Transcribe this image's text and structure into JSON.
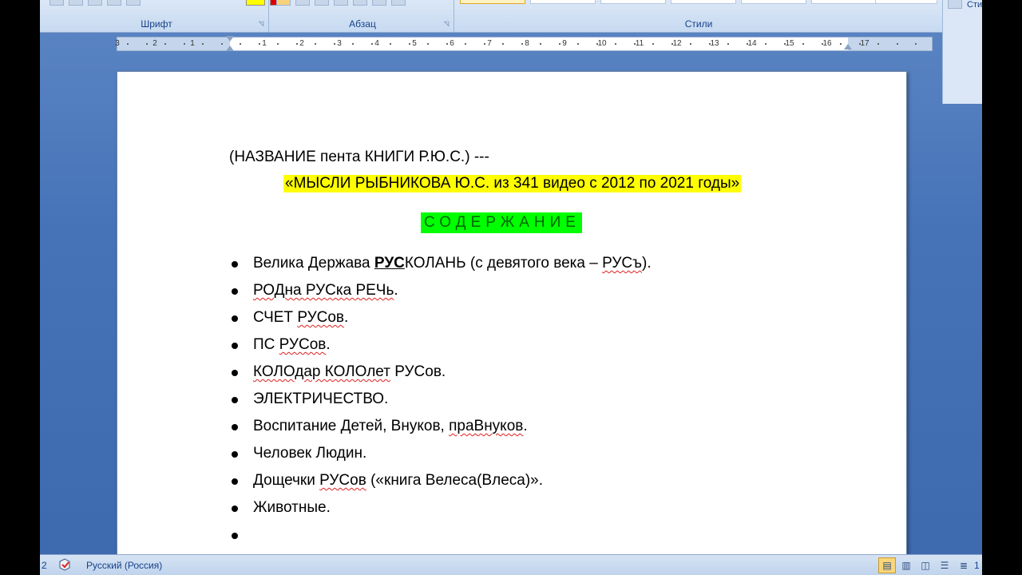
{
  "ribbon": {
    "groups": [
      {
        "label": "Шрифт"
      },
      {
        "label": "Абзац"
      },
      {
        "label": "Стили"
      }
    ],
    "styles_button_label": "Стили"
  },
  "ruler": {
    "left_ticks": [
      "3",
      "2",
      "1"
    ],
    "right_ticks": [
      "1",
      "2",
      "3",
      "4",
      "5",
      "6",
      "7",
      "8",
      "9",
      "10",
      "11",
      "12",
      "13",
      "14",
      "15",
      "16",
      "17"
    ]
  },
  "document": {
    "heading": "(НАЗВАНИЕ пента КНИГИ Р.Ю.С.) ---",
    "title": "«МЫСЛИ РЫБНИКОВА Ю.С. из 341 видео с 2012 по 2021 годы»",
    "contents_label": "СОДЕРЖАНИЕ",
    "toc": [
      {
        "a": "Велика Держава ",
        "b": "РУС",
        "c": "КОЛАНЬ (с девятого века – ",
        "d": "РУСъ",
        "e": ")."
      },
      {
        "a": "",
        "b": "",
        "c": "",
        "d": "РОДна РУСка РЕЧь",
        "e": "."
      },
      {
        "a": "СЧЕТ ",
        "b": "",
        "c": "",
        "d": "РУСов",
        "e": "."
      },
      {
        "a": "ПС ",
        "b": "",
        "c": "",
        "d": "РУСов",
        "e": "."
      },
      {
        "a": "",
        "b": "",
        "c": "",
        "d": "КОЛОдар КОЛОлет",
        "e": " РУСов."
      },
      {
        "a": "ЭЛЕКТРИЧЕСТВО.",
        "b": "",
        "c": "",
        "d": "",
        "e": ""
      },
      {
        "a": "Воспитание Детей, Внуков, ",
        "b": "",
        "c": "",
        "d": "праВнуков",
        "e": "."
      },
      {
        "a": "Человек Людин.",
        "b": "",
        "c": "",
        "d": "",
        "e": ""
      },
      {
        "a": "Дощечки ",
        "b": "",
        "c": "",
        "d": "РУСов",
        "e": " («книга Велеса(Влеса)»."
      },
      {
        "a": "Животные.",
        "b": "",
        "c": "",
        "d": "",
        "e": ""
      },
      {
        "a": "",
        "b": "",
        "c": "",
        "d": "",
        "e": ""
      }
    ]
  },
  "statusbar": {
    "page_indicator": "2",
    "language": "Русский (Россия)",
    "zoom_partial": "1"
  },
  "colors": {
    "title_highlight": "#ffff00",
    "contents_highlight": "#00ff00",
    "contents_text": "#006600",
    "ribbon_text": "#15428b"
  },
  "icons": [
    "spellcheck-icon",
    "print-layout-icon",
    "full-screen-reading-icon",
    "web-layout-icon",
    "outline-icon",
    "draft-icon"
  ]
}
